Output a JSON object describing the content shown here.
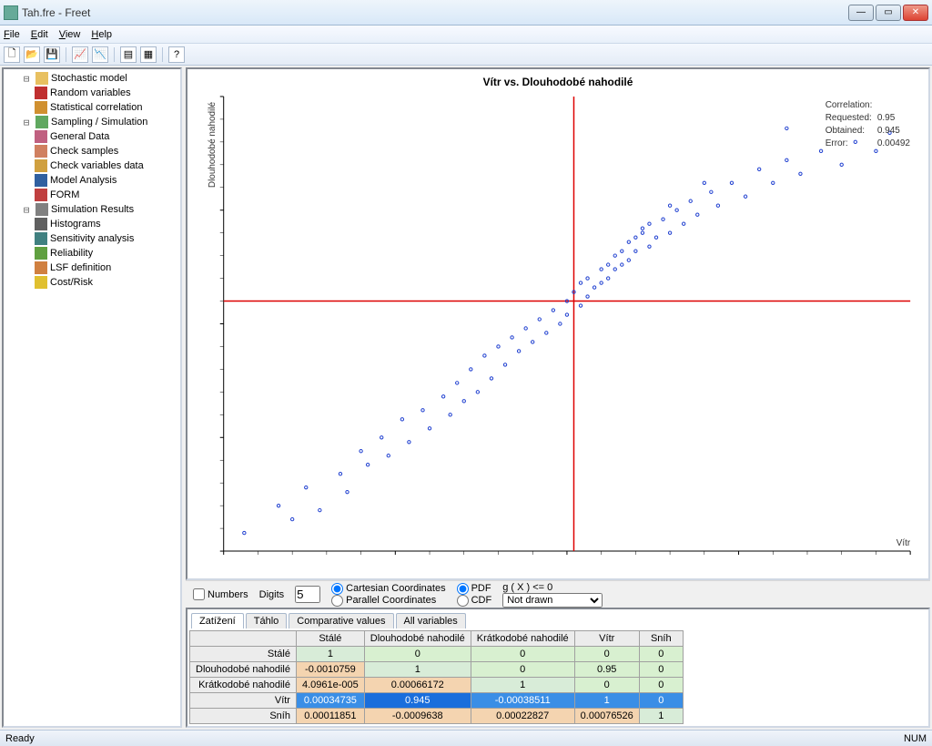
{
  "window": {
    "title": "Tah.fre - Freet",
    "menu": {
      "file": "File",
      "edit": "Edit",
      "view": "View",
      "help": "Help"
    },
    "toolbar_icons": [
      "new",
      "open",
      "save",
      "run1",
      "run2",
      "bars1",
      "bars2",
      "help"
    ],
    "status": {
      "left": "Ready",
      "right": "NUM"
    }
  },
  "tree": {
    "root": "Stochastic model",
    "root_children": [
      "Random variables",
      "Statistical correlation"
    ],
    "sampling": "Sampling / Simulation",
    "sampling_children": [
      "General Data",
      "Check samples",
      "Check variables data",
      "Model Analysis",
      "FORM"
    ],
    "results": "Simulation Results",
    "results_children": [
      "Histograms",
      "Sensitivity analysis",
      "Reliability",
      "LSF definition",
      "Cost/Risk"
    ]
  },
  "controls": {
    "numbers_label": "Numbers",
    "digits_label": "Digits",
    "digits_value": "5",
    "coord_cart": "Cartesian Coordinates",
    "coord_par": "Parallel Coordinates",
    "pdf": "PDF",
    "cdf": "CDF",
    "gx_label": "g ( X ) <= 0",
    "notdrawn": "Not drawn"
  },
  "tabs": {
    "zatizeni": "Zatížení",
    "tahlo": "Táhlo",
    "comparative": "Comparative values",
    "allvars": "All variables"
  },
  "matrix": {
    "headers": [
      "Stálé",
      "Dlouhodobé nahodilé",
      "Krátkodobé nahodilé",
      "Vítr",
      "Sníh"
    ],
    "rows": [
      {
        "name": "Stálé",
        "cells": [
          {
            "v": "1",
            "c": "diag"
          },
          {
            "v": "0",
            "c": "green"
          },
          {
            "v": "0",
            "c": "green"
          },
          {
            "v": "0",
            "c": "green"
          },
          {
            "v": "0",
            "c": "green"
          }
        ]
      },
      {
        "name": "Dlouhodobé nahodilé",
        "cells": [
          {
            "v": "-0.0010759",
            "c": "orange"
          },
          {
            "v": "1",
            "c": "diag"
          },
          {
            "v": "0",
            "c": "green"
          },
          {
            "v": "0.95",
            "c": "green"
          },
          {
            "v": "0",
            "c": "green"
          }
        ]
      },
      {
        "name": "Krátkodobé nahodilé",
        "cells": [
          {
            "v": "4.0961e-005",
            "c": "orange"
          },
          {
            "v": "0.00066172",
            "c": "orange"
          },
          {
            "v": "1",
            "c": "diag"
          },
          {
            "v": "0",
            "c": "green"
          },
          {
            "v": "0",
            "c": "green"
          }
        ]
      },
      {
        "name": "Vítr",
        "cells": [
          {
            "v": "0.00034735",
            "c": "blue"
          },
          {
            "v": "0.945",
            "c": "sel"
          },
          {
            "v": "-0.00038511",
            "c": "blue"
          },
          {
            "v": "1",
            "c": "blue"
          },
          {
            "v": "0",
            "c": "blue"
          }
        ]
      },
      {
        "name": "Sníh",
        "cells": [
          {
            "v": "0.00011851",
            "c": "orange"
          },
          {
            "v": "-0.0009638",
            "c": "orange"
          },
          {
            "v": "0.00022827",
            "c": "orange"
          },
          {
            "v": "0.00076526",
            "c": "orange"
          },
          {
            "v": "1",
            "c": "diag"
          }
        ]
      }
    ]
  },
  "chart_data": {
    "type": "scatter",
    "title": "Vítr vs. Dlouhodobé nahodilé",
    "xlabel": "Vítr",
    "ylabel": "Dlouhodobé nahodilé",
    "correlation": {
      "requested": "0.95",
      "obtained": "0.945",
      "error": "0.00492"
    },
    "correlation_labels": {
      "title": "Correlation:",
      "requested": "Requested:",
      "obtained": "Obtained:",
      "error": "Error:"
    },
    "crosshair": {
      "x": 0.51,
      "y": 0.55
    },
    "points": [
      [
        0.03,
        0.04
      ],
      [
        0.08,
        0.1
      ],
      [
        0.1,
        0.07
      ],
      [
        0.12,
        0.14
      ],
      [
        0.14,
        0.09
      ],
      [
        0.17,
        0.17
      ],
      [
        0.18,
        0.13
      ],
      [
        0.2,
        0.22
      ],
      [
        0.21,
        0.19
      ],
      [
        0.23,
        0.25
      ],
      [
        0.24,
        0.21
      ],
      [
        0.26,
        0.29
      ],
      [
        0.27,
        0.24
      ],
      [
        0.29,
        0.31
      ],
      [
        0.3,
        0.27
      ],
      [
        0.32,
        0.34
      ],
      [
        0.33,
        0.3
      ],
      [
        0.34,
        0.37
      ],
      [
        0.35,
        0.33
      ],
      [
        0.36,
        0.4
      ],
      [
        0.37,
        0.35
      ],
      [
        0.38,
        0.43
      ],
      [
        0.39,
        0.38
      ],
      [
        0.4,
        0.45
      ],
      [
        0.41,
        0.41
      ],
      [
        0.42,
        0.47
      ],
      [
        0.43,
        0.44
      ],
      [
        0.44,
        0.49
      ],
      [
        0.45,
        0.46
      ],
      [
        0.46,
        0.51
      ],
      [
        0.47,
        0.48
      ],
      [
        0.48,
        0.53
      ],
      [
        0.49,
        0.5
      ],
      [
        0.5,
        0.55
      ],
      [
        0.5,
        0.52
      ],
      [
        0.51,
        0.57
      ],
      [
        0.52,
        0.54
      ],
      [
        0.52,
        0.59
      ],
      [
        0.53,
        0.56
      ],
      [
        0.53,
        0.6
      ],
      [
        0.54,
        0.58
      ],
      [
        0.55,
        0.62
      ],
      [
        0.55,
        0.59
      ],
      [
        0.56,
        0.63
      ],
      [
        0.56,
        0.6
      ],
      [
        0.57,
        0.65
      ],
      [
        0.57,
        0.62
      ],
      [
        0.58,
        0.66
      ],
      [
        0.58,
        0.63
      ],
      [
        0.59,
        0.68
      ],
      [
        0.59,
        0.64
      ],
      [
        0.6,
        0.69
      ],
      [
        0.6,
        0.66
      ],
      [
        0.61,
        0.7
      ],
      [
        0.62,
        0.67
      ],
      [
        0.62,
        0.72
      ],
      [
        0.63,
        0.69
      ],
      [
        0.64,
        0.73
      ],
      [
        0.65,
        0.7
      ],
      [
        0.66,
        0.75
      ],
      [
        0.67,
        0.72
      ],
      [
        0.68,
        0.77
      ],
      [
        0.69,
        0.74
      ],
      [
        0.71,
        0.79
      ],
      [
        0.72,
        0.76
      ],
      [
        0.74,
        0.81
      ],
      [
        0.76,
        0.78
      ],
      [
        0.78,
        0.84
      ],
      [
        0.8,
        0.81
      ],
      [
        0.82,
        0.86
      ],
      [
        0.84,
        0.83
      ],
      [
        0.87,
        0.88
      ],
      [
        0.9,
        0.85
      ],
      [
        0.92,
        0.9
      ],
      [
        0.95,
        0.88
      ],
      [
        0.97,
        0.92
      ],
      [
        0.82,
        0.93
      ],
      [
        0.7,
        0.81
      ],
      [
        0.65,
        0.76
      ],
      [
        0.61,
        0.71
      ]
    ]
  }
}
